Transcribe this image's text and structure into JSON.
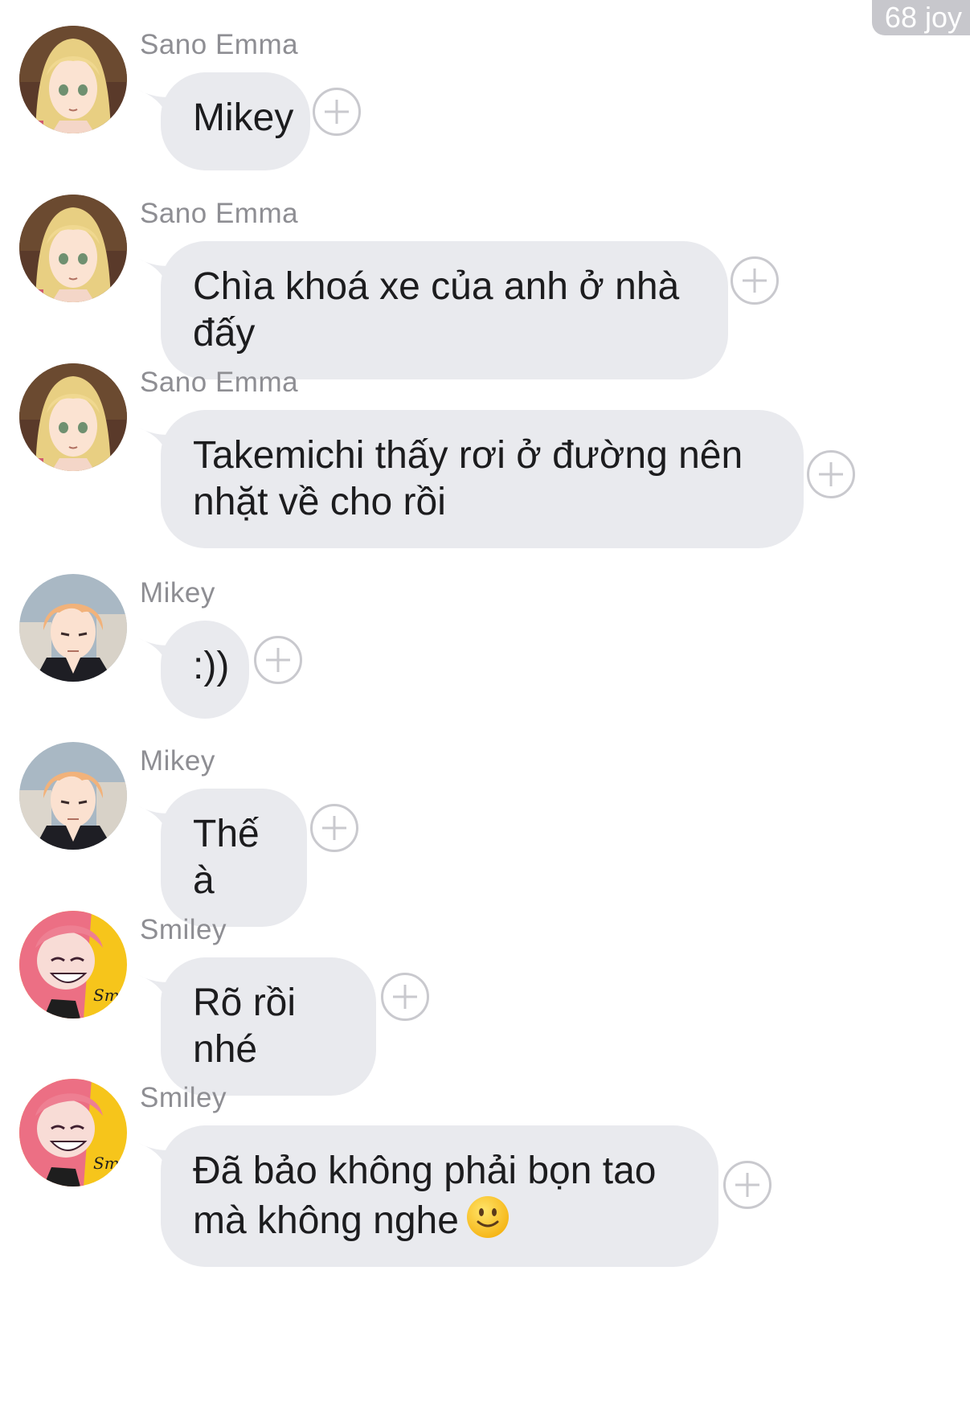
{
  "status_badge": "68 joy",
  "messages": [
    {
      "sender": "Sano Emma",
      "avatar": "emma-avatar",
      "text": "Mikey"
    },
    {
      "sender": "Sano Emma",
      "avatar": "emma-avatar",
      "text": "Chìa khoá xe của anh ở nhà đấy"
    },
    {
      "sender": "Sano Emma",
      "avatar": "emma-avatar",
      "text": "Takemichi thấy rơi ở đường nên nhặt về cho rồi"
    },
    {
      "sender": "Mikey",
      "avatar": "mikey-avatar",
      "text": ":))"
    },
    {
      "sender": "Mikey",
      "avatar": "mikey-avatar",
      "text": "Thế à"
    },
    {
      "sender": "Smiley",
      "avatar": "smiley-avatar",
      "text": "Rõ rồi nhé"
    },
    {
      "sender": "Smiley",
      "avatar": "smiley-avatar",
      "text": "Đã bảo không phải bọn tao mà không nghe",
      "emoji": "slightly-smiling-face"
    }
  ],
  "colors": {
    "bubble": "#e9eaee",
    "sender_name": "#8e8e93",
    "text": "#1c1c1e",
    "plus_icon": "#c9c9ce",
    "badge": "#c7c7cc"
  }
}
